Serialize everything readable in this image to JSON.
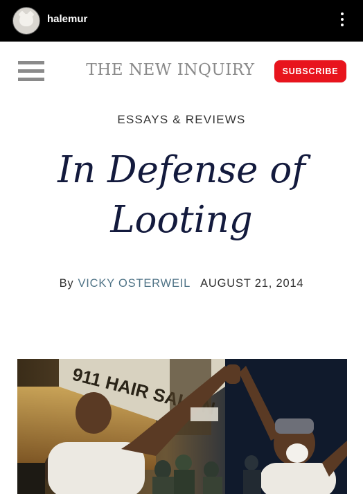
{
  "app": {
    "username": "halemur"
  },
  "site": {
    "title": "THE NEW INQUIRY",
    "subscribe_label": "SUBSCRIBE"
  },
  "article": {
    "section": "ESSAYS & REVIEWS",
    "headline_line1": "In Defense of",
    "headline_line2": "Looting",
    "by_label": "By",
    "author": "VICKY OSTERWEIL",
    "date": "AUGUST 21, 2014",
    "image_sign_text": "911 HAIR SALON"
  },
  "colors": {
    "accent": "#e8141d",
    "headline": "#131a3d",
    "author_link": "#4f7386"
  },
  "icons": [
    "avatar",
    "more-vertical-icon",
    "hamburger-menu-icon"
  ]
}
